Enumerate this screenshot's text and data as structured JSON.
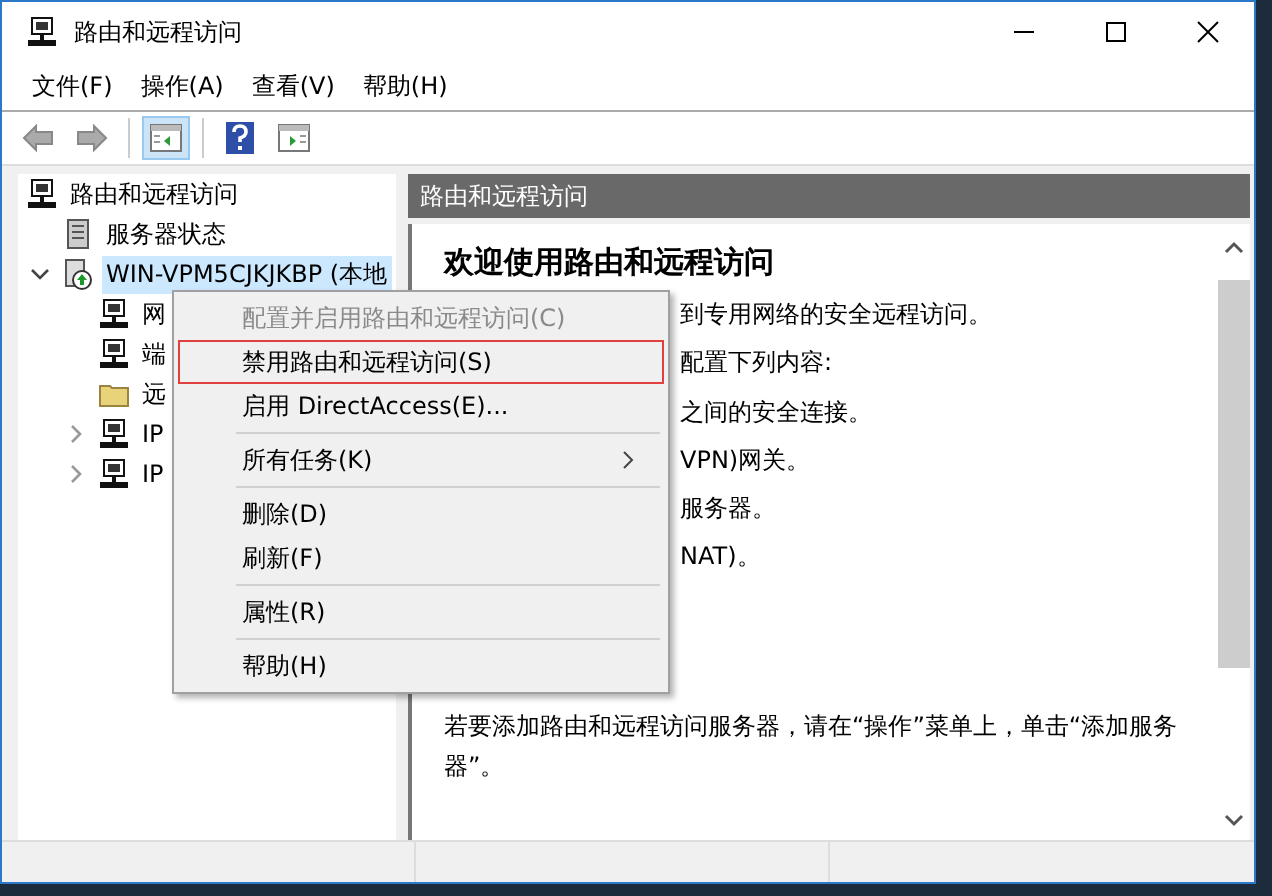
{
  "window": {
    "title": "路由和远程访问"
  },
  "menu_bar": [
    "文件(F)",
    "操作(A)",
    "查看(V)",
    "帮助(H)"
  ],
  "toolbar": [
    {
      "kind": "back",
      "pressed": false
    },
    {
      "kind": "forward",
      "pressed": false
    },
    {
      "kind": "tree-toggle",
      "pressed": true
    },
    {
      "kind": "help",
      "pressed": false
    },
    {
      "kind": "action-pane",
      "pressed": false
    }
  ],
  "tree": [
    {
      "label": "路由和远程访问",
      "kind": "console",
      "selected": false,
      "children": [
        {
          "label": "服务器状态",
          "kind": "server",
          "selected": false
        },
        {
          "label": "WIN-VPM5CJKJKBP (本地",
          "kind": "router",
          "selected": true,
          "expanded": true,
          "children": [
            {
              "label": "网",
              "kind": "console",
              "selected": false
            },
            {
              "label": "端",
              "kind": "console",
              "selected": false
            },
            {
              "label": "远",
              "kind": "folder",
              "selected": false
            },
            {
              "label": "IP",
              "kind": "console",
              "selected": false,
              "expanded": false
            },
            {
              "label": "IP",
              "kind": "console",
              "selected": false,
              "expanded": false
            }
          ]
        }
      ]
    }
  ],
  "pane": {
    "header": "路由和远程访问",
    "title": "欢迎使用路由和远程访问",
    "lines": [
      "到专用网络的安全远程访问。",
      "配置下列内容:",
      "之间的安全连接。",
      "VPN)网关。",
      "服务器。",
      "NAT)。"
    ],
    "note": "若要添加路由和远程访问服务器，请在“操作”菜单上，单击“添加服务器”。"
  },
  "context_menu": [
    {
      "kind": "item",
      "label": "配置并启用路由和远程访问(C)",
      "disabled": true,
      "selected": false
    },
    {
      "kind": "item",
      "label": "禁用路由和远程访问(S)",
      "disabled": false,
      "selected": true
    },
    {
      "kind": "item",
      "label": "启用 DirectAccess(E)...",
      "disabled": false,
      "selected": false
    },
    {
      "kind": "separator"
    },
    {
      "kind": "item",
      "label": "所有任务(K)",
      "disabled": false,
      "selected": false,
      "submenu": true
    },
    {
      "kind": "separator"
    },
    {
      "kind": "item",
      "label": "删除(D)",
      "disabled": false,
      "selected": false
    },
    {
      "kind": "item",
      "label": "刷新(F)",
      "disabled": false,
      "selected": false
    },
    {
      "kind": "separator"
    },
    {
      "kind": "item",
      "label": "属性(R)",
      "disabled": false,
      "selected": false
    },
    {
      "kind": "separator"
    },
    {
      "kind": "item",
      "label": "帮助(H)",
      "disabled": false,
      "selected": false
    }
  ]
}
